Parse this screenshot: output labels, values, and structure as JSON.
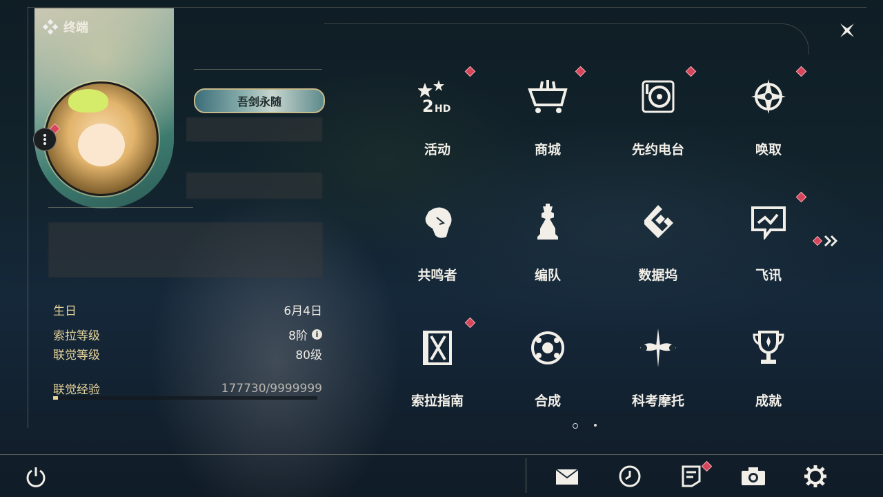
{
  "header": {
    "title": "终端"
  },
  "profile": {
    "rank_badge": "吾剑永随",
    "info": [
      {
        "label": "生日",
        "value": "6月4日"
      },
      {
        "label": "索拉等级",
        "value": "8阶"
      },
      {
        "label": "联觉等级",
        "value": "80级"
      }
    ],
    "exp": {
      "label": "联觉经验",
      "value": "177730/9999999",
      "progress": 0.0178
    },
    "level_info_icon": "info-icon"
  },
  "menu": {
    "tiles": [
      {
        "label": "活动",
        "icon": "activity-icon",
        "badge": true
      },
      {
        "label": "商城",
        "icon": "shop-icon",
        "badge": true
      },
      {
        "label": "先约电台",
        "icon": "radio-icon",
        "badge": true
      },
      {
        "label": "唤取",
        "icon": "summon-icon",
        "badge": true
      },
      {
        "label": "共鸣者",
        "icon": "resonator-icon",
        "badge": false
      },
      {
        "label": "编队",
        "icon": "team-icon",
        "badge": false
      },
      {
        "label": "数据坞",
        "icon": "data-dock-icon",
        "badge": false
      },
      {
        "label": "飞讯",
        "icon": "message-icon",
        "badge": true
      },
      {
        "label": "索拉指南",
        "icon": "guide-icon",
        "badge": true
      },
      {
        "label": "合成",
        "icon": "synthesis-icon",
        "badge": false
      },
      {
        "label": "科考摩托",
        "icon": "motorcycle-icon",
        "badge": false
      },
      {
        "label": "成就",
        "icon": "trophy-icon",
        "badge": false
      }
    ],
    "page_current": 1,
    "page_count": 2
  },
  "bottom_bar": {
    "icons": [
      "power-icon",
      "mail-icon",
      "clock-icon",
      "notes-icon",
      "camera-icon",
      "settings-icon"
    ]
  },
  "colors": {
    "accent_gold": "#e8d59b",
    "badge_red": "#d6455a",
    "text": "#f2efe8"
  }
}
